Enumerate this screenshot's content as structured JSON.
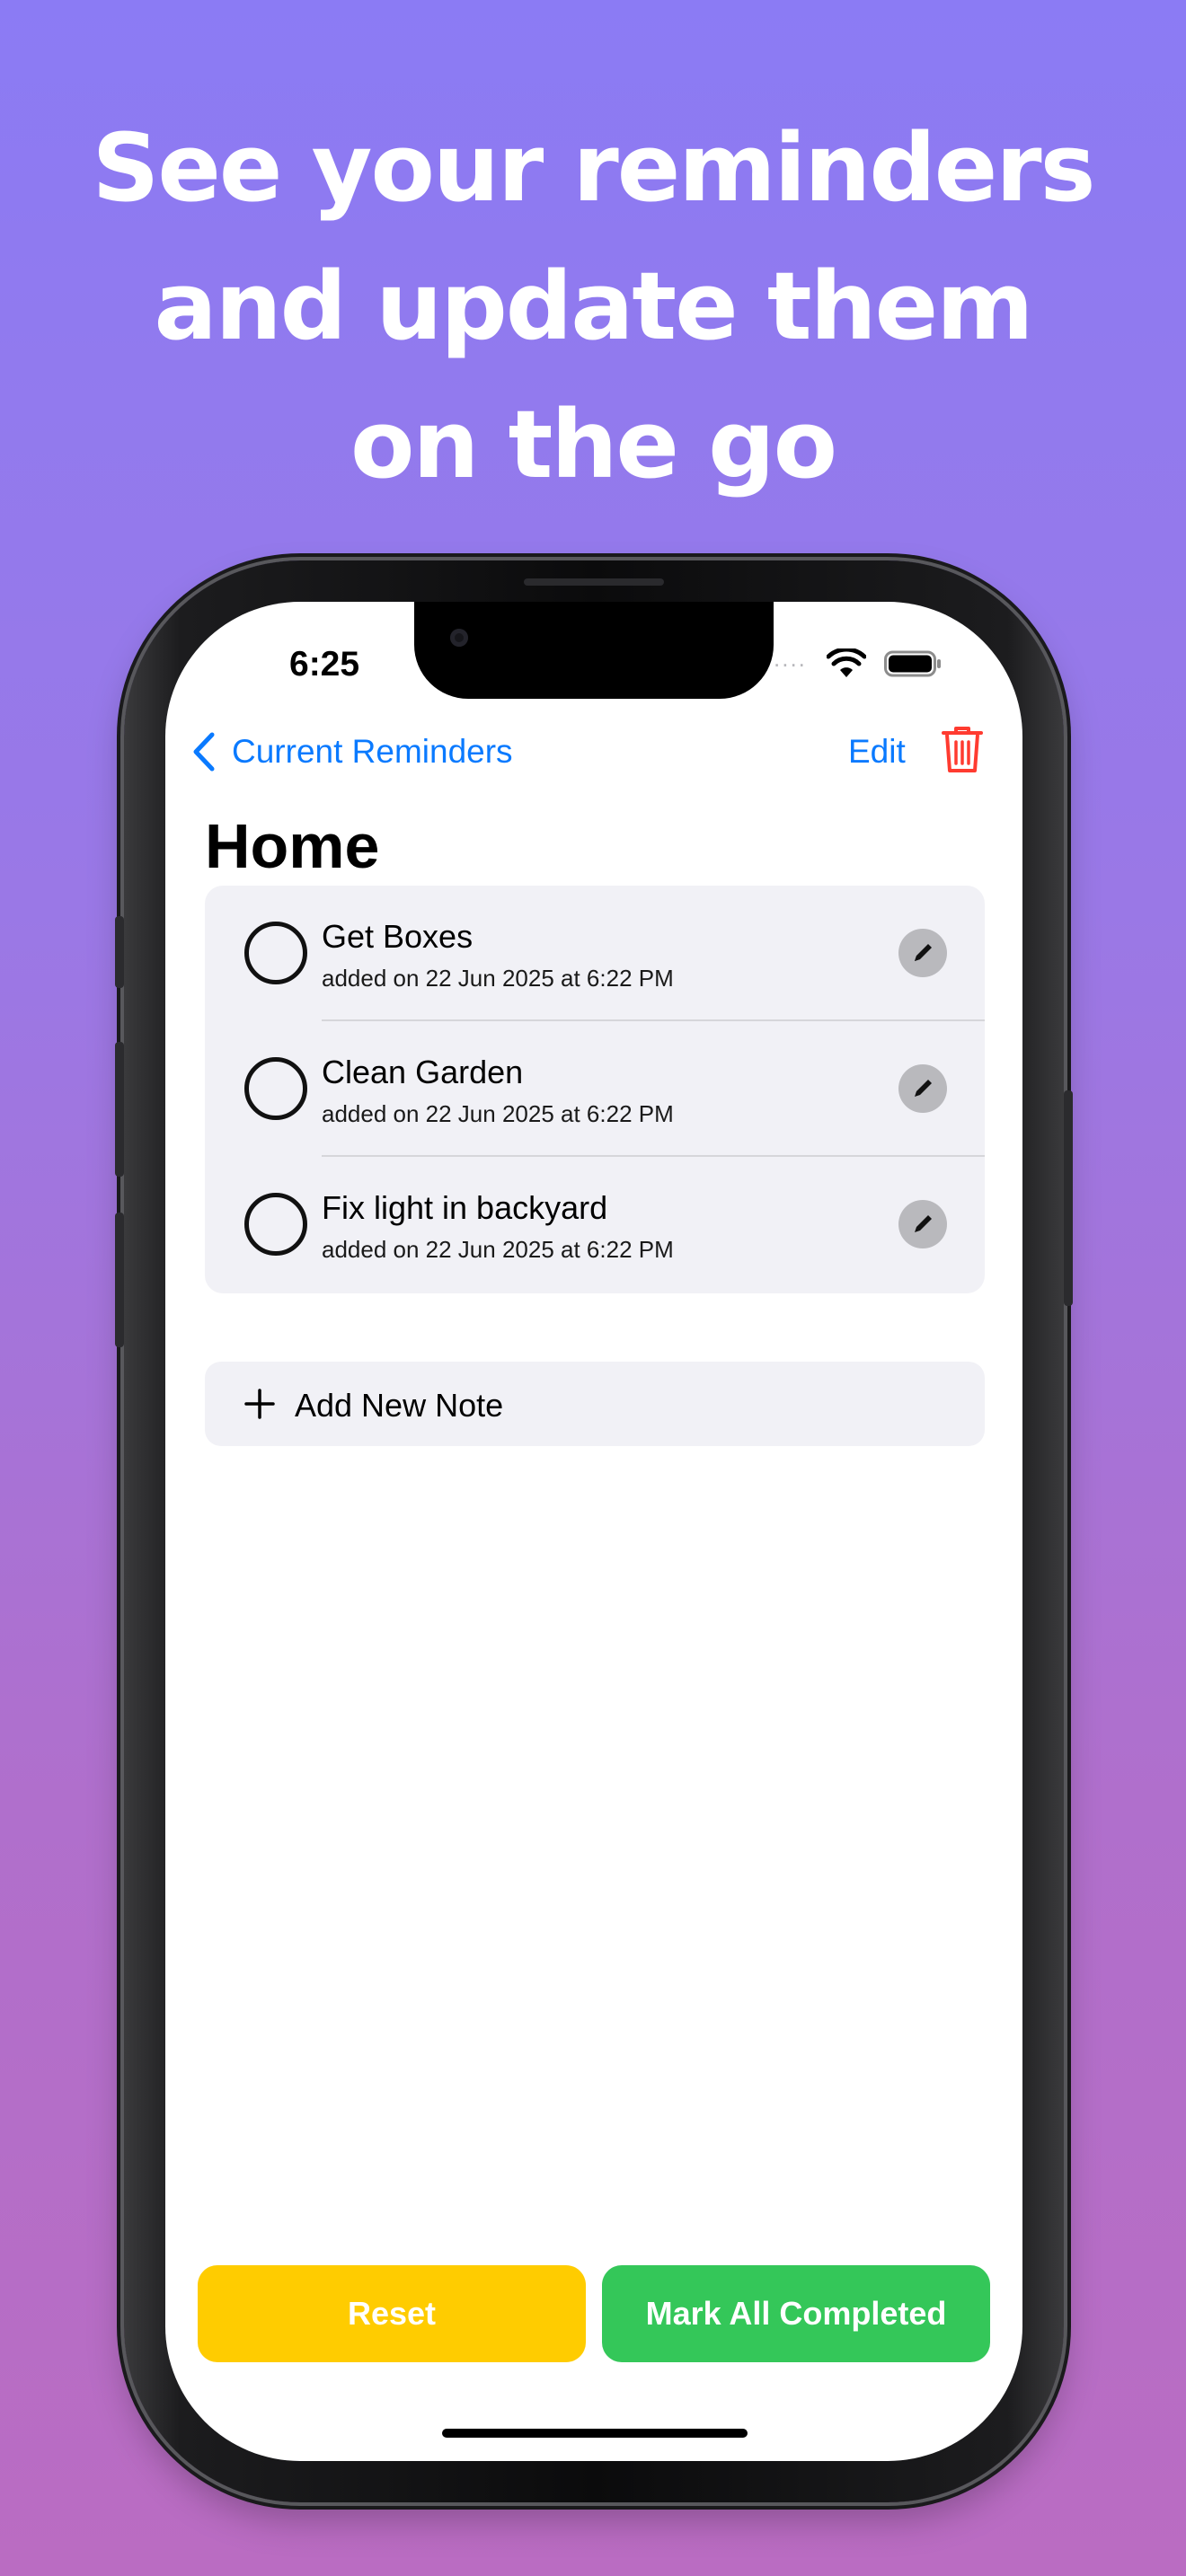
{
  "headline": {
    "line1": "See your reminders",
    "line2": "and update them",
    "line3": "on the go"
  },
  "status_bar": {
    "time": "6:25",
    "signal": "....",
    "wifi_icon": "wifi-icon",
    "battery_icon": "battery-icon"
  },
  "nav": {
    "back_label": "Current Reminders",
    "edit_label": "Edit",
    "trash_icon": "trash-icon"
  },
  "page": {
    "title": "Home"
  },
  "reminders": [
    {
      "title": "Get Boxes",
      "subtitle": "added on 22 Jun 2025 at 6:22 PM"
    },
    {
      "title": "Clean Garden",
      "subtitle": "added on 22 Jun 2025 at 6:22 PM"
    },
    {
      "title": "Fix light in backyard",
      "subtitle": "added on 22 Jun 2025 at 6:22 PM"
    }
  ],
  "add_note": {
    "label": "Add New Note"
  },
  "actions": {
    "reset_label": "Reset",
    "complete_label": "Mark All Completed"
  },
  "colors": {
    "accent_blue": "#0a7aff",
    "destructive_red": "#ff3b30",
    "reset_yellow": "#ffcc00",
    "complete_green": "#34c759",
    "card_background": "#f1f1f6"
  }
}
